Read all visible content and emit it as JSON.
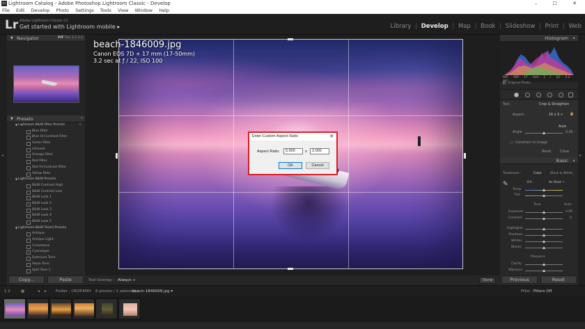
{
  "window": {
    "title": "Lightroom Catalog - Adobe Photoshop Lightroom Classic - Develop",
    "lr_icon": "Lr",
    "controls": "– ☐ ✕"
  },
  "menu": [
    "File",
    "Edit",
    "Develop",
    "Photo",
    "Settings",
    "Tools",
    "View",
    "Window",
    "Help"
  ],
  "identity": {
    "logo": "Lr",
    "catalog_label": "Adobe Lightroom Classic CC",
    "mobile": "Get started with Lightroom mobile ▸"
  },
  "modules": {
    "library": "Library",
    "develop": "Develop",
    "map": "Map",
    "book": "Book",
    "slideshow": "Slideshow",
    "print": "Print",
    "web": "Web",
    "separator": "|"
  },
  "navigator": {
    "title": "Navigator",
    "zoom_fit": "FIT",
    "zoom_fill": "FILL",
    "zoom_1": "1:1",
    "zoom_2": "1:2"
  },
  "presets": {
    "title": "Presets",
    "groups": [
      {
        "name": "Lightroom B&W Filter Presets",
        "items": [
          "Blue Filter",
          "Blue Hi-Contrast Filter",
          "Green Filter",
          "Infrared",
          "Orange Filter",
          "Red Filter",
          "Red Hi-Contrast Filter",
          "Yellow Filter"
        ]
      },
      {
        "name": "Lightroom B&W Presets",
        "items": [
          "B&W Contrast High",
          "B&W Contrast Low",
          "B&W Look 1",
          "B&W Look 2",
          "B&W Look 3",
          "B&W Look 4",
          "B&W Look 5"
        ]
      },
      {
        "name": "Lightroom B&W Toned Presets",
        "items": [
          "Antique",
          "Antique Light",
          "Creamtone",
          "Cyanotype",
          "Selenium Tone",
          "Sepia Tone",
          "Split Tone 1"
        ]
      }
    ]
  },
  "left_buttons": {
    "copy": "Copy...",
    "paste": "Paste"
  },
  "photo_info": {
    "filename": "beach-1846009.jpg",
    "camera": "Canon EOS 7D + 17 mm (17-50mm)",
    "exposure": "3.2 sec at ƒ / 22, ISO 100"
  },
  "dialog": {
    "title": "Enter Custom Aspect Ratio",
    "close": "✕",
    "label": "Aspect Ratio:",
    "width_value": "5.000",
    "x": "x",
    "height_value": "2.000",
    "ok": "OK",
    "cancel": "Cancel"
  },
  "toolbar": {
    "label": "Tool Overlay :",
    "value": "Always ÷",
    "done": "Done"
  },
  "histogram": {
    "title": "Histogram",
    "readout": [
      "ISO 100",
      "17 mm",
      "ƒ / 22",
      "3.2 sec"
    ],
    "original": "Original Photo"
  },
  "crop": {
    "tool_label": "Tool :",
    "tool_name": "Crop & Straighten",
    "aspect_label": "Aspect :",
    "aspect_value": "16 x 9 ÷",
    "auto": "Auto",
    "angle_label": "Angle",
    "angle_value": "0.00",
    "constrain": "Constrain to Image",
    "reset": "Reset",
    "close": "Close"
  },
  "basic": {
    "title": "Basic",
    "treatment_label": "Treatment :",
    "color": "Color",
    "bw": "Black & White",
    "wb_label": "WB :",
    "wb_value": "As Shot ÷",
    "temp": "Temp",
    "tint": "Tint",
    "tone": "Tone",
    "tone_auto": "Auto",
    "exposure": "Exposure",
    "exposure_value": "0.00",
    "contrast": "Contrast",
    "contrast_value": "0",
    "highlights": "Highlights",
    "shadows": "Shadows",
    "whites": "Whites",
    "blacks": "Blacks",
    "presence": "Presence",
    "clarity": "Clarity",
    "vibrance": "Vibrance"
  },
  "right_buttons": {
    "previous": "Previous",
    "reset": "Reset"
  },
  "filmstrip": {
    "views": "1  2",
    "source": "Folder : CROP.KNH",
    "count": "6 photos / 1 selected /",
    "path": "beach-1846009.jpg ▾",
    "filter_label": "Filter :",
    "filter_value": "Filters Off"
  },
  "colors": {
    "accent_red": "#d81f26",
    "panel_bg": "#282828",
    "photo_sky": "#7b5fb8"
  }
}
